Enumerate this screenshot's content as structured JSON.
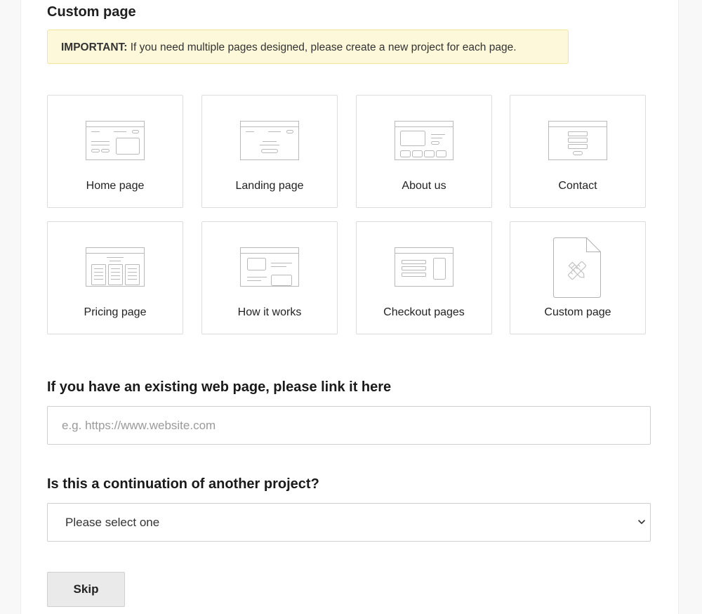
{
  "header": {
    "title": "Custom page"
  },
  "notice": {
    "strong": "IMPORTANT:",
    "text": "If you need multiple pages designed, please create a new project for each page."
  },
  "page_types": [
    {
      "label": "Home page",
      "icon": "home-page-wireframe-icon"
    },
    {
      "label": "Landing page",
      "icon": "landing-page-wireframe-icon"
    },
    {
      "label": "About us",
      "icon": "about-us-wireframe-icon"
    },
    {
      "label": "Contact",
      "icon": "contact-wireframe-icon"
    },
    {
      "label": "Pricing page",
      "icon": "pricing-page-wireframe-icon"
    },
    {
      "label": "How it works",
      "icon": "how-it-works-wireframe-icon"
    },
    {
      "label": "Checkout pages",
      "icon": "checkout-wireframe-icon"
    },
    {
      "label": "Custom page",
      "icon": "custom-page-document-icon"
    }
  ],
  "existing_page": {
    "heading": "If you have an existing web page, please link it here",
    "placeholder": "e.g. https://www.website.com",
    "value": ""
  },
  "continuation": {
    "heading": "Is this a continuation of another project?",
    "selected": "Please select one"
  },
  "actions": {
    "skip_label": "Skip"
  },
  "colors": {
    "notice_bg": "#fcf8d9",
    "notice_border": "#f2e59a",
    "card_border": "#dcdcdc",
    "button_bg": "#eaeaea"
  }
}
